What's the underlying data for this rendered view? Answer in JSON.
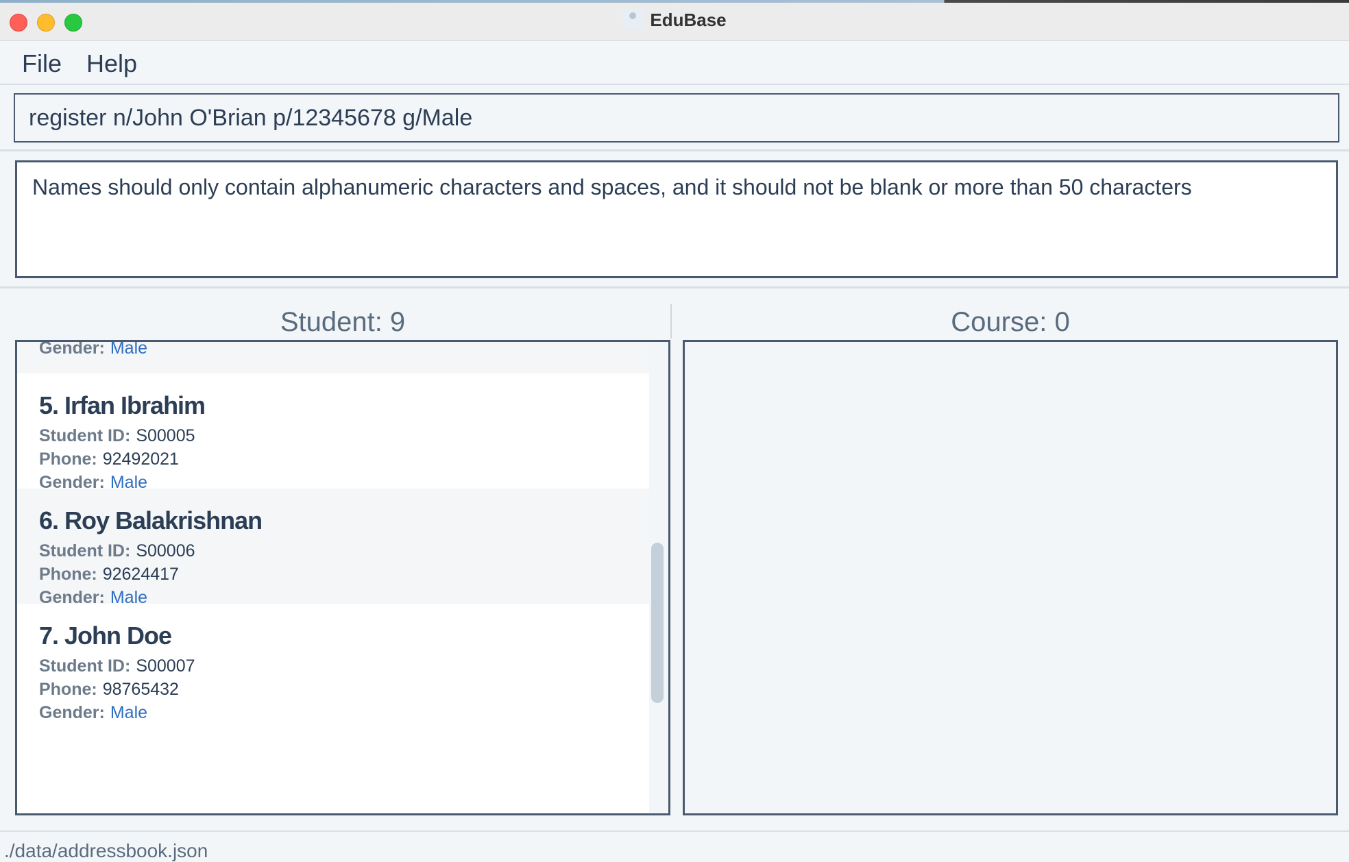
{
  "window": {
    "title": "EduBase"
  },
  "menu": {
    "file": "File",
    "help": "Help"
  },
  "command": {
    "value": "register n/John O'Brian p/12345678 g/Male"
  },
  "result": {
    "message": "Names should only contain alphanumeric characters and spaces, and it should not be blank or more than 50 characters"
  },
  "students": {
    "title": "Student: 9",
    "labels": {
      "id": "Student ID:",
      "phone": "Phone:",
      "gender": "Gender:"
    },
    "partial_gender": "Male",
    "items": [
      {
        "name": "5.  Irfan Ibrahim",
        "id": "S00005",
        "phone": "92492021",
        "gender": "Male"
      },
      {
        "name": "6.  Roy Balakrishnan",
        "id": "S00006",
        "phone": "92624417",
        "gender": "Male"
      },
      {
        "name": "7.  John Doe",
        "id": "S00007",
        "phone": "98765432",
        "gender": "Male"
      }
    ]
  },
  "courses": {
    "title": "Course: 0"
  },
  "status": {
    "path": "./data/addressbook.json"
  },
  "colors": {
    "accent_link": "#2f6fc0",
    "border": "#4a5a6e",
    "background": "#f3f6f9"
  }
}
